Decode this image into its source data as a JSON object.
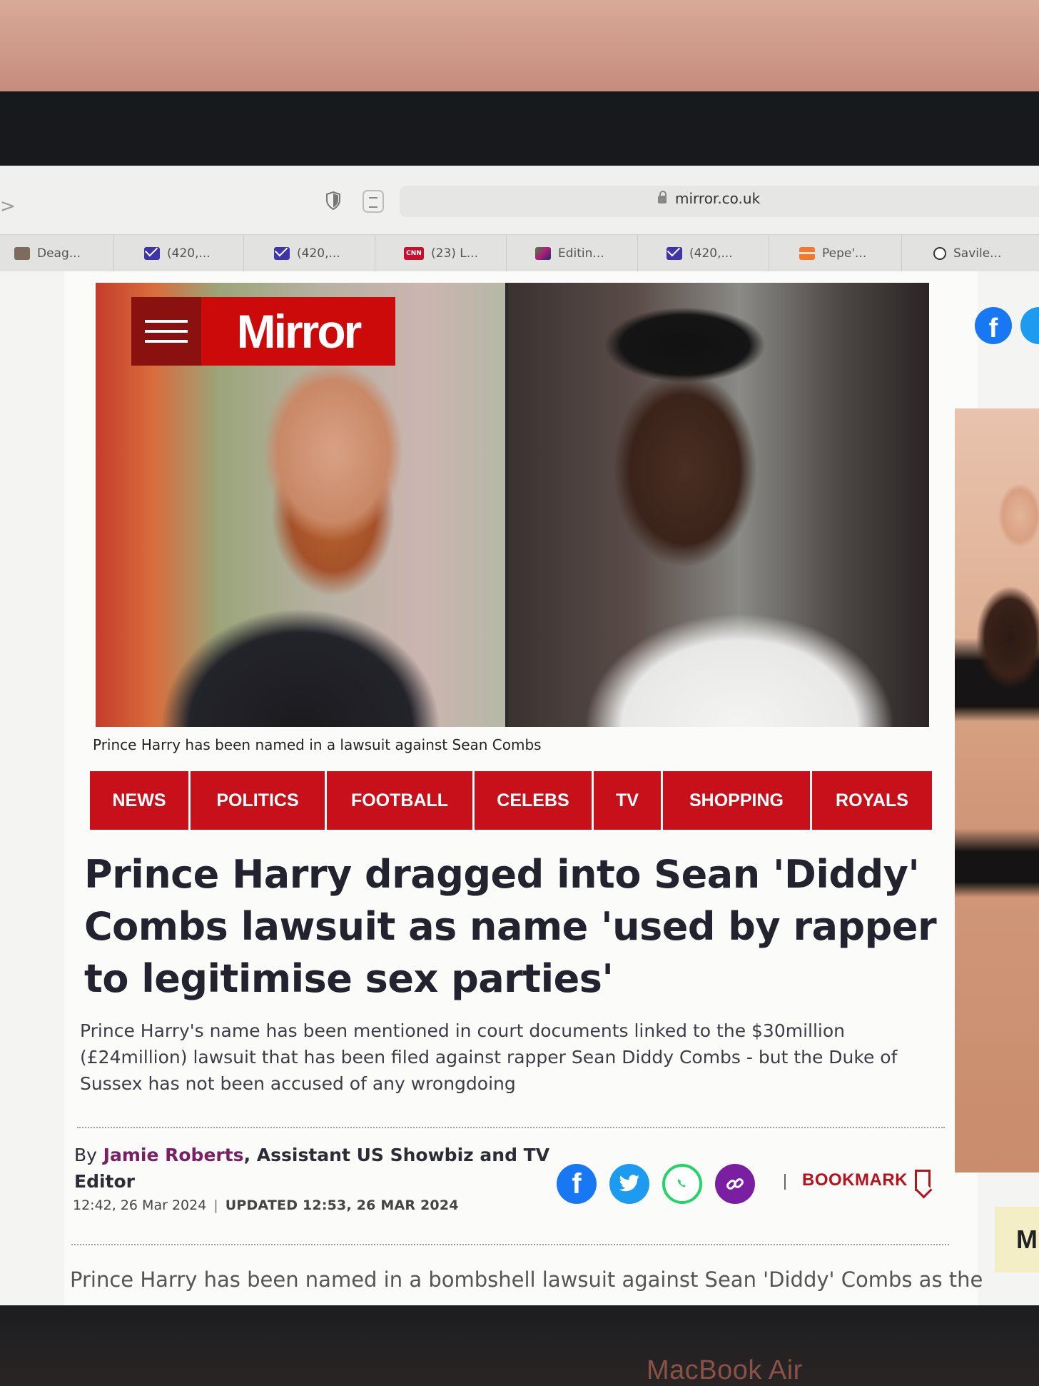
{
  "browser": {
    "url": "mirror.co.uk",
    "tabs": [
      {
        "label": "Deag...",
        "favicon": "image-favicon"
      },
      {
        "label": "(420,...",
        "favicon": "mail-favicon"
      },
      {
        "label": "(420,...",
        "favicon": "mail-favicon"
      },
      {
        "label": "(23) L...",
        "favicon": "cnn-favicon"
      },
      {
        "label": "Editin...",
        "favicon": "gradient-favicon"
      },
      {
        "label": "(420,...",
        "favicon": "mail-favicon"
      },
      {
        "label": "Pepe'...",
        "favicon": "bookmark-favicon"
      },
      {
        "label": "Savile...",
        "favicon": "globe-favicon"
      }
    ]
  },
  "brand": {
    "logo_text": "Mirror",
    "color": "#cc0a0a"
  },
  "hero": {
    "caption": "Prince Harry has been named in a lawsuit against Sean Combs"
  },
  "nav": [
    "NEWS",
    "POLITICS",
    "FOOTBALL",
    "CELEBS",
    "TV",
    "SHOPPING",
    "ROYALS"
  ],
  "article": {
    "headline": "Prince Harry dragged into Sean 'Diddy' Combs lawsuit as name 'used by rapper to legitimise sex parties'",
    "standfirst": "Prince Harry's name has been mentioned in court documents linked to the $30million (£24million) lawsuit that has been filed against rapper Sean Diddy Combs - but the Duke of Sussex has not been accused of any wrongdoing",
    "byline_prefix": "By",
    "author": "Jamie Roberts",
    "author_role": ", Assistant US Showbiz and TV Editor",
    "published": "12:42, 26 Mar 2024",
    "separator": "|",
    "updated": "UPDATED 12:53, 26 MAR 2024",
    "bookmark_label": "BOOKMARK",
    "body_first_line": "Prince Harry has been named in a bombshell lawsuit against Sean 'Diddy' Combs as the"
  },
  "share": [
    "facebook-icon",
    "twitter-icon",
    "whatsapp-icon",
    "link-icon"
  ],
  "rail": {
    "ad_letter": "M"
  },
  "device": {
    "label": "MacBook Air"
  }
}
